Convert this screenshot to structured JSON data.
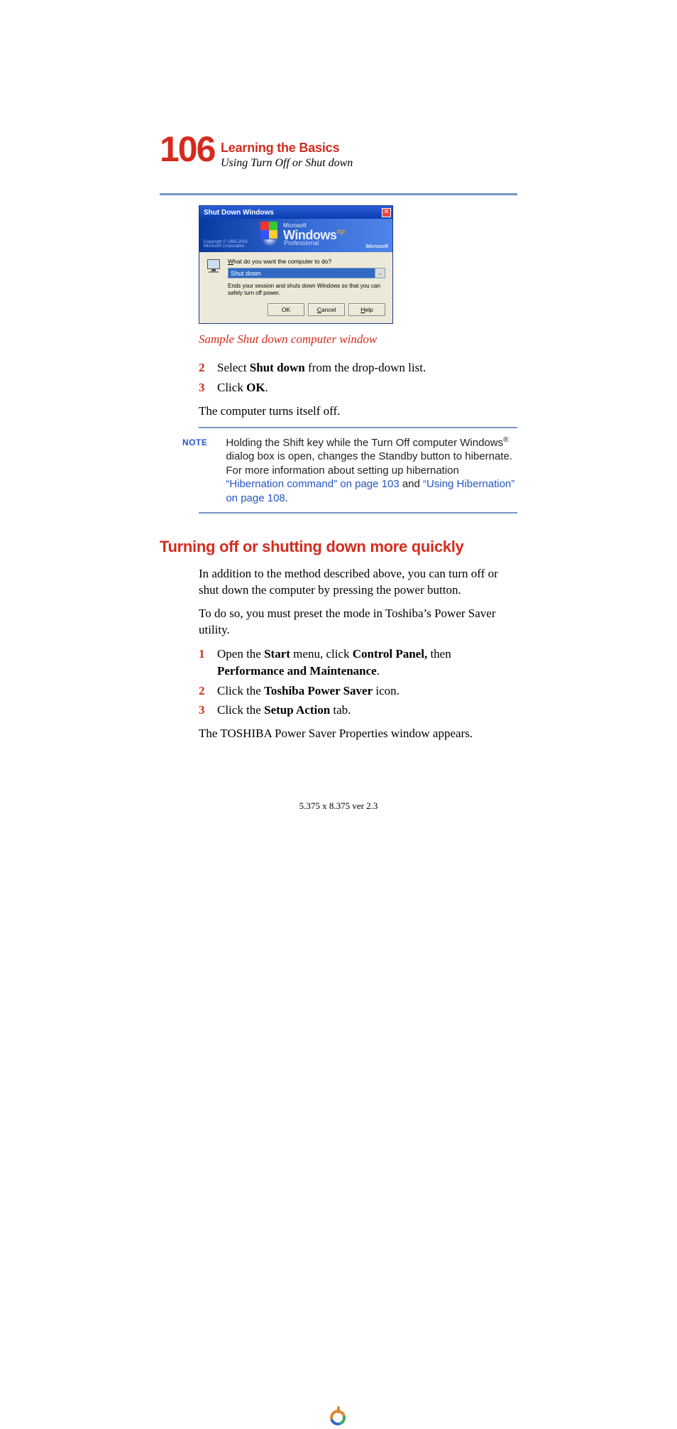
{
  "header": {
    "pageNumber": "106",
    "chapter": "Learning the Basics",
    "section": "Using Turn Off or Shut down"
  },
  "dialog": {
    "title": "Shut Down Windows",
    "closeGlyph": "×",
    "bannerMicrosoft": "Microsoft",
    "bannerWindows": "Windows",
    "bannerXP": "xp",
    "bannerPro": "Professional",
    "copyright": "Copyright © 1985-2001",
    "corp": "Microsoft Corporation",
    "msLogo": "Microsoft",
    "question_pre": "W",
    "question_rest": "hat do you want the computer to do?",
    "selectValue": "Shut down",
    "arrowGlyph": "⌄",
    "description": "Ends your session and shuts down Windows so that you can safely turn off power.",
    "okLabel": "OK",
    "cancelAccel": "C",
    "cancelRest": "ancel",
    "helpAccel": "H",
    "helpRest": "elp"
  },
  "caption": "Sample Shut down computer window",
  "steps_a": {
    "s2_num": "2",
    "s2_a": "Select ",
    "s2_b": "Shut down",
    "s2_c": " from the drop-down list.",
    "s3_num": "3",
    "s3_a": "Click ",
    "s3_b": "OK",
    "s3_c": "."
  },
  "after_steps_a": "The computer turns itself off.",
  "note": {
    "label": "NOTE",
    "t1": "Holding the Shift key while the Turn Off computer Windows",
    "reg": "®",
    "t2": " dialog box is open, changes the Standby button to hibernate. For more information about setting up hibernation ",
    "link1": "“Hibernation command” on page 103",
    "mid": " and ",
    "link2": "“Using Hibernation” on page 108",
    "end": "."
  },
  "h2": "Turning off or shutting down more quickly",
  "para1": "In addition to the method described above, you can turn off or shut down the computer by pressing the power button.",
  "para2": "To do so, you must preset the mode in Toshiba’s Power Saver utility.",
  "steps_b": {
    "s1_num": "1",
    "s1_a": "Open the ",
    "s1_b": "Start",
    "s1_c": " menu, click ",
    "s1_d": "Control Panel,",
    "s1_e": " then ",
    "s1_f": "Performance and Maintenance",
    "s1_g": ".",
    "s2_num": "2",
    "s2_a": "Click the ",
    "s2_b": "Toshiba Power Saver",
    "s2_c": " icon.",
    "s3_num": "3",
    "s3_a": "Click the ",
    "s3_b": "Setup Action",
    "s3_c": " tab."
  },
  "after_steps_b": "The TOSHIBA Power Saver Properties window appears.",
  "footer": "5.375 x 8.375 ver 2.3"
}
